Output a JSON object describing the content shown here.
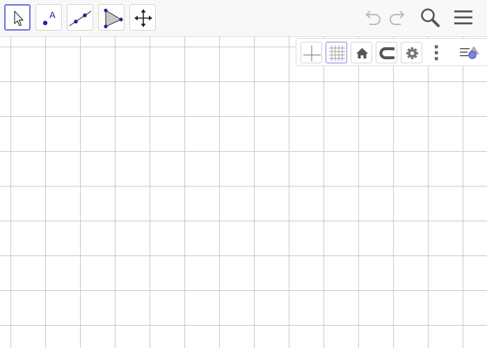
{
  "toolbar": {
    "tools": [
      {
        "name": "move-tool",
        "icon": "arrow-pointer-icon",
        "selected": true
      },
      {
        "name": "point-tool",
        "icon": "point-with-label-icon",
        "label": "A"
      },
      {
        "name": "line-tool",
        "icon": "line-through-points-icon"
      },
      {
        "name": "polygon-tool",
        "icon": "polygon-icon"
      },
      {
        "name": "move-graphics-view-tool",
        "icon": "four-way-arrow-icon"
      }
    ],
    "right": {
      "undo": {
        "icon": "undo-icon",
        "enabled": false
      },
      "redo": {
        "icon": "redo-icon",
        "enabled": false
      },
      "search": {
        "icon": "search-icon"
      },
      "menu": {
        "icon": "hamburger-menu-icon"
      }
    }
  },
  "style_bar": {
    "buttons": [
      {
        "name": "axes-toggle",
        "icon": "axes-icon",
        "active": false
      },
      {
        "name": "grid-toggle",
        "icon": "grid-icon",
        "active": true
      },
      {
        "name": "standard-view",
        "icon": "home-icon"
      },
      {
        "name": "point-capturing",
        "icon": "magnet-icon"
      },
      {
        "name": "graphics-settings",
        "icon": "gear-icon"
      },
      {
        "name": "more-options",
        "icon": "vertical-dots-icon"
      },
      {
        "name": "view-menu",
        "icon": "view-menu-icon"
      }
    ]
  },
  "colors": {
    "accent": "#6a73d8",
    "point_blue": "#1d24a8",
    "grid_line": "#c9c9c9",
    "icon_dark": "#555555",
    "disabled": "#bbbbbb"
  }
}
